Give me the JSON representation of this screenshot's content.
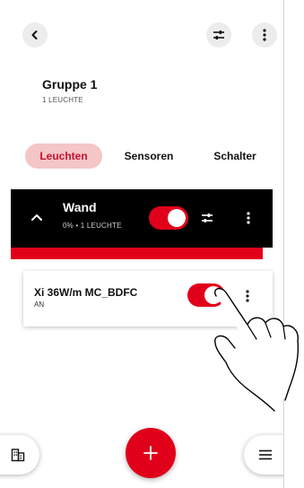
{
  "colors": {
    "accent": "#e1001a",
    "tab_active_bg": "#f4c6c6",
    "header_bg": "#000000"
  },
  "header": {
    "back_icon": "chevron-left-icon",
    "settings_icon": "sliders-icon",
    "more_icon": "more-vertical-icon"
  },
  "group": {
    "title": "Gruppe 1",
    "subtitle": "1 LEUCHTE"
  },
  "tabs": [
    {
      "label": "Leuchten",
      "active": true
    },
    {
      "label": "Sensoren",
      "active": false
    },
    {
      "label": "Schalter",
      "active": false
    }
  ],
  "area": {
    "name": "Wand",
    "subtitle": "0% • 1 LEUCHTE",
    "toggle_on": true
  },
  "device": {
    "name": "Xi 36W/m MC_BDFC",
    "status": "AN",
    "toggle_on": true
  },
  "bottom": {
    "left_icon": "building-icon",
    "fab_icon": "plus-icon",
    "right_icon": "menu-icon"
  }
}
